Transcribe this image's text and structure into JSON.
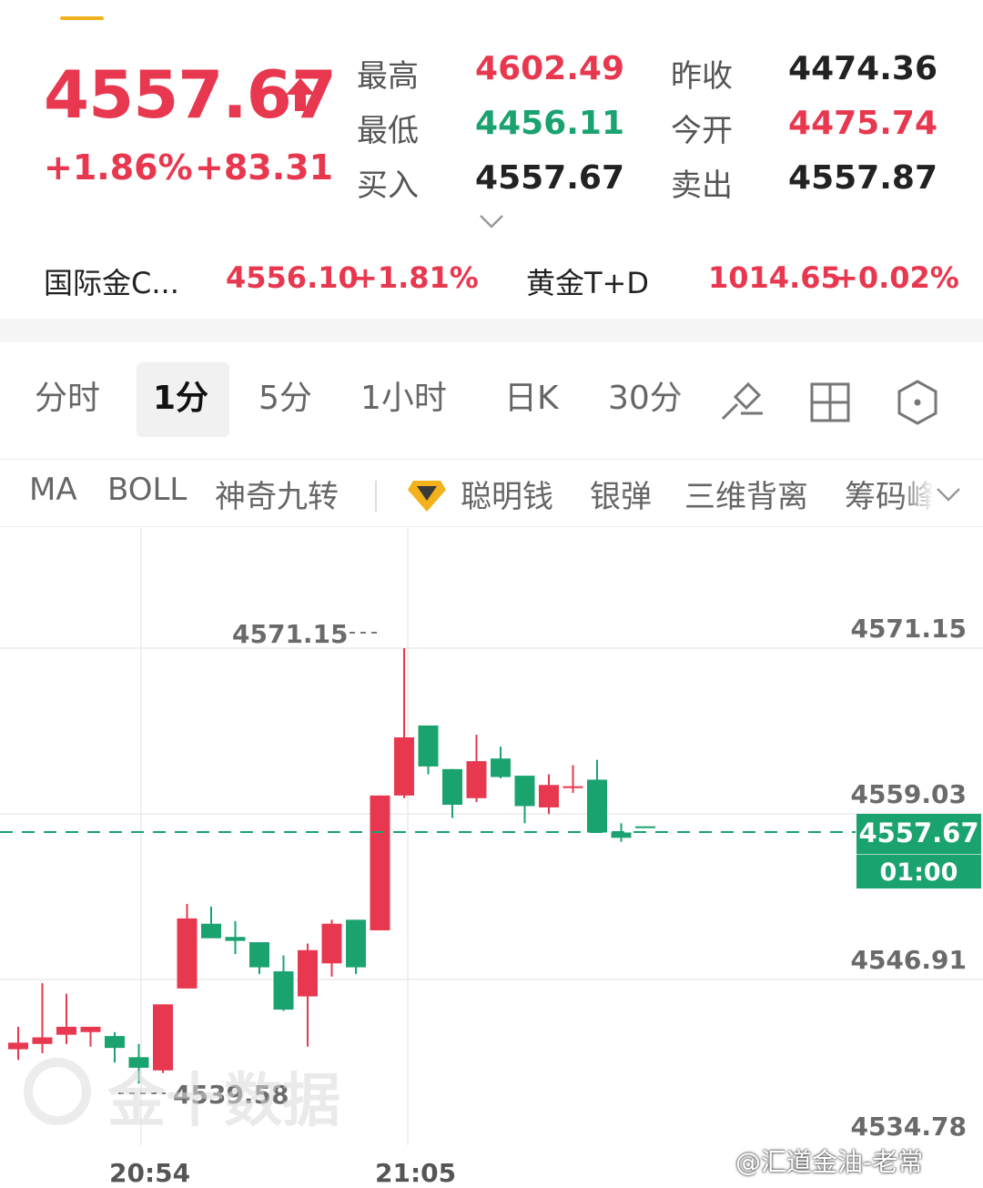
{
  "header": {
    "tab_fragment": "",
    "price": "4557.67",
    "change_pct": "+1.86%",
    "change_abs": "+83.31",
    "stats": {
      "high_label": "最高",
      "high": "4602.49",
      "prev_close_label": "昨收",
      "prev_close": "4474.36",
      "low_label": "最低",
      "low": "4456.11",
      "open_label": "今开",
      "open": "4475.74",
      "bid_label": "买入",
      "bid": "4557.67",
      "ask_label": "卖出",
      "ask": "4557.87"
    }
  },
  "tickers": [
    {
      "name": "国际金C...",
      "price": "4556.10",
      "change": "+1.81%"
    },
    {
      "name": "黄金T+D",
      "price": "1014.65",
      "change": "+0.02%"
    }
  ],
  "timeframes": [
    "分时",
    "1分",
    "5分",
    "1小时",
    "日K",
    "30分"
  ],
  "timeframe_active": "1分",
  "toolbar_icons": [
    "draw-tool-icon",
    "layout-grid-icon",
    "settings-hexagon-icon"
  ],
  "indicators": [
    "MA",
    "BOLL",
    "神奇九转",
    "聪明钱",
    "银弹",
    "三维背离",
    "筹码峰"
  ],
  "chart": {
    "y_labels": [
      "4571.15",
      "4559.03",
      "4546.91",
      "4534.78"
    ],
    "high_annotation": "4571.15",
    "low_annotation": "4539.58",
    "current_price": "4557.67",
    "countdown": "01:00",
    "x_labels": [
      "20:54",
      "21:05"
    ],
    "watermark": "金十数据"
  },
  "credit": "@汇道金油-老常",
  "colors": {
    "up": "#e8384f",
    "down": "#1aa36f",
    "accent": "#f3b21c"
  },
  "chart_data": {
    "type": "candlestick",
    "ylim": [
      4534.78,
      4571.15
    ],
    "candles": [
      {
        "o": 4540.8,
        "h": 4542.5,
        "l": 4540.0,
        "c": 4541.3,
        "dir": "up"
      },
      {
        "o": 4541.2,
        "h": 4545.8,
        "l": 4540.5,
        "c": 4541.7,
        "dir": "up"
      },
      {
        "o": 4541.9,
        "h": 4545.0,
        "l": 4541.2,
        "c": 4542.5,
        "dir": "up"
      },
      {
        "o": 4542.1,
        "h": 4542.3,
        "l": 4541.0,
        "c": 4542.5,
        "dir": "up"
      },
      {
        "o": 4541.8,
        "h": 4542.1,
        "l": 4539.8,
        "c": 4540.9,
        "dir": "down"
      },
      {
        "o": 4540.2,
        "h": 4541.2,
        "l": 4538.2,
        "c": 4539.4,
        "dir": "down"
      },
      {
        "o": 4539.2,
        "h": 4543.4,
        "l": 4539.0,
        "c": 4544.2,
        "dir": "up"
      },
      {
        "o": 4545.4,
        "h": 4551.8,
        "l": 4545.4,
        "c": 4550.7,
        "dir": "up"
      },
      {
        "o": 4550.3,
        "h": 4551.6,
        "l": 4549.6,
        "c": 4549.2,
        "dir": "down"
      },
      {
        "o": 4549.3,
        "h": 4550.5,
        "l": 4548.0,
        "c": 4549.0,
        "dir": "down"
      },
      {
        "o": 4548.9,
        "h": 4548.9,
        "l": 4546.5,
        "c": 4547.0,
        "dir": "down"
      },
      {
        "o": 4546.7,
        "h": 4547.9,
        "l": 4543.7,
        "c": 4543.8,
        "dir": "down"
      },
      {
        "o": 4544.8,
        "h": 4548.8,
        "l": 4541.0,
        "c": 4548.3,
        "dir": "up"
      },
      {
        "o": 4547.3,
        "h": 4550.6,
        "l": 4546.3,
        "c": 4550.3,
        "dir": "up"
      },
      {
        "o": 4550.6,
        "h": 4550.6,
        "l": 4546.5,
        "c": 4547.0,
        "dir": "down"
      },
      {
        "o": 4549.8,
        "h": 4559.0,
        "l": 4549.8,
        "c": 4560.0,
        "dir": "up"
      },
      {
        "o": 4560.0,
        "h": 4571.15,
        "l": 4559.8,
        "c": 4564.4,
        "dir": "up"
      },
      {
        "o": 4565.3,
        "h": 4565.3,
        "l": 4561.6,
        "c": 4562.2,
        "dir": "down"
      },
      {
        "o": 4562.0,
        "h": 4562.0,
        "l": 4558.3,
        "c": 4559.3,
        "dir": "down"
      },
      {
        "o": 4559.8,
        "h": 4564.6,
        "l": 4559.5,
        "c": 4562.6,
        "dir": "up"
      },
      {
        "o": 4562.8,
        "h": 4563.7,
        "l": 4561.3,
        "c": 4561.4,
        "dir": "down"
      },
      {
        "o": 4561.5,
        "h": 4561.5,
        "l": 4557.9,
        "c": 4559.2,
        "dir": "down"
      },
      {
        "o": 4559.1,
        "h": 4561.6,
        "l": 4558.6,
        "c": 4560.8,
        "dir": "up"
      },
      {
        "o": 4560.7,
        "h": 4562.3,
        "l": 4560.2,
        "c": 4560.7,
        "dir": "up"
      },
      {
        "o": 4561.2,
        "h": 4562.7,
        "l": 4557.6,
        "c": 4557.2,
        "dir": "down"
      },
      {
        "o": 4557.2,
        "h": 4557.9,
        "l": 4556.5,
        "c": 4556.8,
        "dir": "down"
      },
      {
        "o": 4557.67,
        "h": 4557.67,
        "l": 4557.67,
        "c": 4557.67,
        "dir": "down"
      }
    ]
  }
}
